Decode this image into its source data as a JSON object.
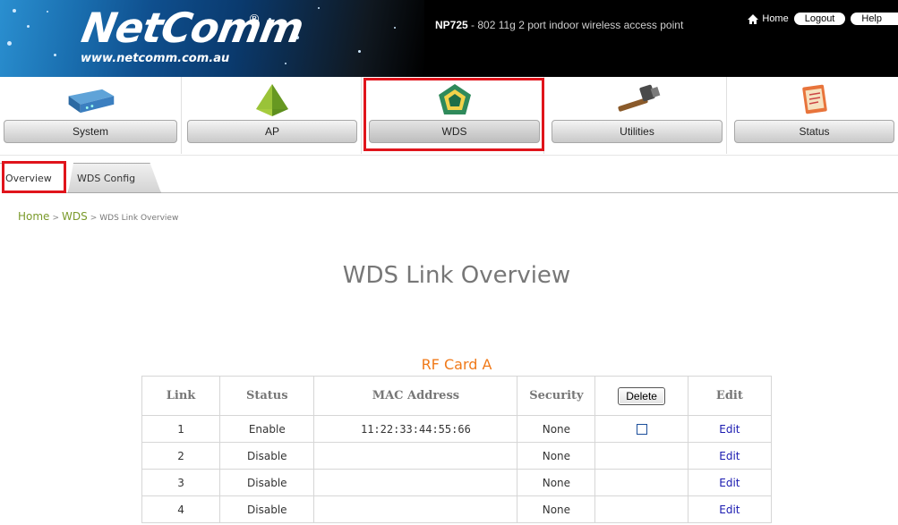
{
  "header": {
    "logo_text": "NetComm",
    "logo_mark": "®",
    "logo_url": "www.netcomm.com.au",
    "model_bold": "NP725",
    "model_rest": " - 802 11g 2 port indoor wireless access point",
    "links": {
      "home": "Home",
      "logout": "Logout",
      "help": "Help"
    },
    "icon": "home-icon"
  },
  "nav": {
    "items": [
      {
        "label": "System",
        "icon": "device-icon"
      },
      {
        "label": "AP",
        "icon": "pyramid-icon"
      },
      {
        "label": "WDS",
        "icon": "wds-pentagon-icon"
      },
      {
        "label": "Utilities",
        "icon": "hammer-icon"
      },
      {
        "label": "Status",
        "icon": "clipboard-icon"
      }
    ],
    "active": "WDS"
  },
  "tabs": [
    {
      "label": "Overview",
      "active": true
    },
    {
      "label": "WDS Config",
      "active": false
    }
  ],
  "breadcrumb": {
    "home": "Home",
    "section": "WDS",
    "current": "WDS Link Overview",
    "sep": ">"
  },
  "page_title": "WDS Link Overview",
  "rf_card": "RF Card A",
  "table": {
    "headers": {
      "link": "Link",
      "status": "Status",
      "mac": "MAC Address",
      "security": "Security",
      "delete": "Delete",
      "edit": "Edit"
    },
    "rows": [
      {
        "link": "1",
        "status": "Enable",
        "mac": "11:22:33:44:55:66",
        "security": "None",
        "edit": "Edit"
      },
      {
        "link": "2",
        "status": "Disable",
        "mac": "",
        "security": "None",
        "edit": "Edit"
      },
      {
        "link": "3",
        "status": "Disable",
        "mac": "",
        "security": "None",
        "edit": "Edit"
      },
      {
        "link": "4",
        "status": "Disable",
        "mac": "",
        "security": "None",
        "edit": "Edit"
      }
    ]
  },
  "colors": {
    "highlight": "#e0141b",
    "accent_orange": "#f07a1a",
    "breadcrumb_green": "#7a9a2a",
    "edit_link": "#1a1ab0"
  }
}
